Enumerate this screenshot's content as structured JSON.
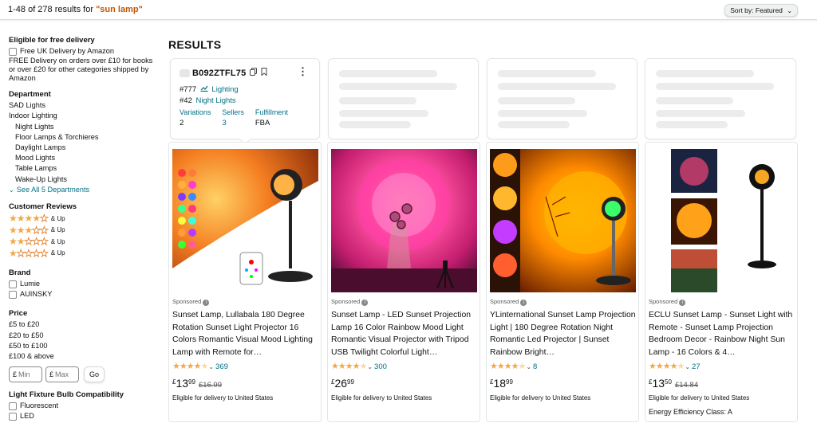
{
  "header": {
    "results_prefix": "1-48 of 278 results for ",
    "query": "\"sun lamp\"",
    "sort_label": "Sort by:",
    "sort_value": "Featured"
  },
  "sidebar": {
    "free_delivery": {
      "heading": "Eligible for free delivery",
      "option": "Free UK Delivery by Amazon",
      "note": "FREE Delivery on orders over £10 for books or over £20 for other categories shipped by Amazon"
    },
    "department": {
      "heading": "Department",
      "items": [
        "SAD Lights",
        "Indoor Lighting",
        "Night Lights",
        "Floor Lamps & Torchieres",
        "Daylight Lamps",
        "Mood Lights",
        "Table Lamps",
        "Wake-Up Lights"
      ],
      "see_all": "See All 5 Departments"
    },
    "reviews": {
      "heading": "Customer Reviews",
      "rows": [
        {
          "stars": "★★★★",
          "empty": "★",
          "label": "& Up"
        },
        {
          "stars": "★★★",
          "empty": "★★",
          "label": "& Up"
        },
        {
          "stars": "★★",
          "empty": "★★★",
          "label": "& Up"
        },
        {
          "stars": "★",
          "empty": "★★★★",
          "label": "& Up"
        }
      ]
    },
    "brand": {
      "heading": "Brand",
      "items": [
        "Lumie",
        "AUINSKY"
      ]
    },
    "price": {
      "heading": "Price",
      "items": [
        "£5 to £20",
        "£20 to £50",
        "£50 to £100",
        "£100 & above"
      ],
      "min_prefix": "£",
      "min_placeholder": "Min",
      "max_prefix": "£",
      "max_placeholder": "Max",
      "go": "Go"
    },
    "bulb": {
      "heading": "Light Fixture Bulb Compatibility",
      "items": [
        "Fluorescent",
        "LED"
      ]
    }
  },
  "main": {
    "heading": "RESULTS",
    "info_card": {
      "asin": "B092ZTFL75",
      "rank1_num": "#777",
      "rank1_cat": "Lighting",
      "rank2_num": "#42",
      "rank2_cat": "Night Lights",
      "variations_label": "Variations",
      "variations_value": "2",
      "sellers_label": "Sellers",
      "sellers_value": "3",
      "fulfillment_label": "Fulfillment",
      "fulfillment_value": "FBA"
    },
    "products": [
      {
        "sponsored": "Sponsored",
        "title": "Sunset Lamp, Lullabala 180 Degree Rotation Sunset Light Projector 16 Colors Romantic Visual Mood Lighting Lamp with Remote for…",
        "stars": "★★★★",
        "half": "★",
        "reviews": "369",
        "currency": "£",
        "whole": "13",
        "fraction": "99",
        "was": "£16.99",
        "delivery": "Eligible for delivery to United States",
        "extra": ""
      },
      {
        "sponsored": "Sponsored",
        "title": "Sunset Lamp - LED Sunset Projection Lamp 16 Color Rainbow Mood Light Romantic Visual Projector with Tripod USB Twilight Colorful Light…",
        "stars": "★★★★",
        "half": "★",
        "reviews": "300",
        "currency": "£",
        "whole": "26",
        "fraction": "99",
        "was": "",
        "delivery": "Eligible for delivery to United States",
        "extra": ""
      },
      {
        "sponsored": "Sponsored",
        "title": "YLinternational Sunset Lamp Projection Light | 180 Degree Rotation Night Romantic Led Projector | Sunset Rainbow Bright…",
        "stars": "★★★★",
        "half": "★",
        "reviews": "8",
        "currency": "£",
        "whole": "18",
        "fraction": "99",
        "was": "",
        "delivery": "Eligible for delivery to United States",
        "extra": ""
      },
      {
        "sponsored": "Sponsored",
        "title": "ECLU Sunset Lamp - Sunset Light with Remote - Sunset Lamp Projection Bedroom Decor - Rainbow Night Sun Lamp - 16 Colors & 4…",
        "stars": "★★★★",
        "half": "★",
        "reviews": "27",
        "currency": "£",
        "whole": "13",
        "fraction": "50",
        "was": "£14.84",
        "delivery": "Eligible for delivery to United States",
        "extra": "Energy Efficiency Class: A"
      }
    ]
  },
  "colors": {
    "link": "#007185",
    "query": "#c45500",
    "star": "#f3a847"
  }
}
